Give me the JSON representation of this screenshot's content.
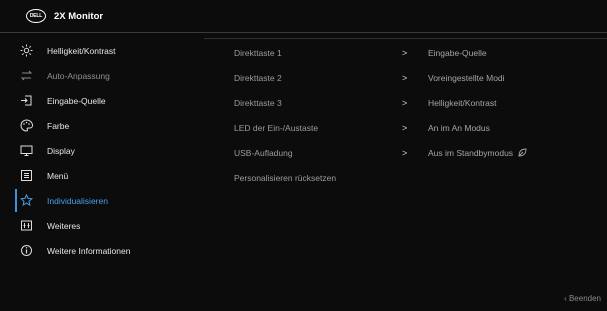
{
  "header": {
    "logo_text": "DELL",
    "model": "2X Monitor"
  },
  "colors": {
    "accent": "#3c93dc",
    "background": "#0c0c0c"
  },
  "sidebar": {
    "items": [
      {
        "label": "Helligkeit/Kontrast",
        "icon": "brightness-icon",
        "state": "normal"
      },
      {
        "label": "Auto-Anpassung",
        "icon": "auto-adjust-icon",
        "state": "disabled"
      },
      {
        "label": "Eingabe-Quelle",
        "icon": "input-source-icon",
        "state": "normal"
      },
      {
        "label": "Farbe",
        "icon": "color-palette-icon",
        "state": "normal"
      },
      {
        "label": "Display",
        "icon": "display-icon",
        "state": "normal"
      },
      {
        "label": "Menü",
        "icon": "menu-icon",
        "state": "normal"
      },
      {
        "label": "Individualisieren",
        "icon": "star-icon",
        "state": "selected"
      },
      {
        "label": "Weiteres",
        "icon": "others-icon",
        "state": "normal"
      },
      {
        "label": "Weitere Informationen",
        "icon": "info-icon",
        "state": "normal"
      }
    ]
  },
  "options": [
    {
      "label": "Direkttaste 1",
      "chevron": ">",
      "value": "Eingabe-Quelle"
    },
    {
      "label": "Direkttaste 2",
      "chevron": ">",
      "value": "Voreingestellte Modi"
    },
    {
      "label": "Direkttaste 3",
      "chevron": ">",
      "value": "Helligkeit/Kontrast"
    },
    {
      "label": "LED der Ein-/Austaste",
      "chevron": ">",
      "value": "An im An Modus"
    },
    {
      "label": "USB-Aufladung",
      "chevron": ">",
      "value": "Aus im Standbymodus"
    },
    {
      "label": "Personalisieren rücksetzen",
      "chevron": "",
      "value": ""
    }
  ],
  "footer": {
    "exit_label": "‹ Beenden"
  }
}
